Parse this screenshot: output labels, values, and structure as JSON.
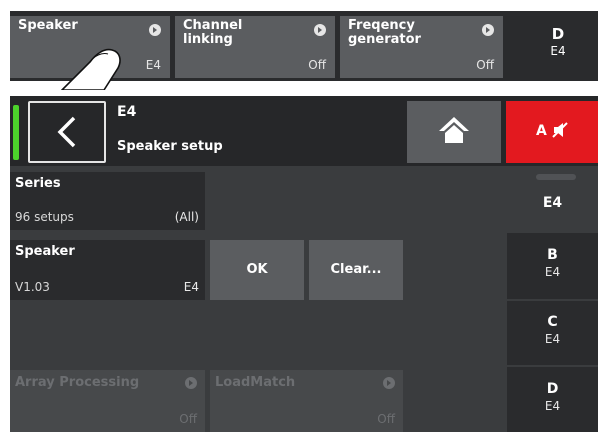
{
  "top_strip": {
    "buttons": [
      {
        "label": "Speaker",
        "value": "E4"
      },
      {
        "label": "Channel linking",
        "label_line1": "Channel",
        "label_line2": "linking",
        "value": "Off"
      },
      {
        "label": "Freqency generator",
        "label_line1": "Freqency",
        "label_line2": "generator",
        "value": "Off"
      }
    ],
    "channel": {
      "letter": "D",
      "speaker": "E4"
    }
  },
  "header": {
    "title": "E4",
    "subtitle": "Speaker setup",
    "mute_label": "A"
  },
  "fields": {
    "series": {
      "label": "Series",
      "left": "96 setups",
      "right": "(All)"
    },
    "speaker": {
      "label": "Speaker",
      "left": "V1.03",
      "right": "E4"
    }
  },
  "actions": {
    "ok": "OK",
    "clear": "Clear..."
  },
  "disabled": {
    "array_processing": {
      "label": "Array Processing",
      "value": "Off"
    },
    "loadmatch": {
      "label": "LoadMatch",
      "value": "Off"
    }
  },
  "channels": [
    {
      "letter": "",
      "speaker": "E4",
      "active": true
    },
    {
      "letter": "B",
      "speaker": "E4"
    },
    {
      "letter": "C",
      "speaker": "E4"
    },
    {
      "letter": "D",
      "speaker": "E4"
    }
  ],
  "colors": {
    "mute_red": "#e3191f",
    "status_green": "#4cd32b",
    "button_grey": "#5b5d60"
  }
}
